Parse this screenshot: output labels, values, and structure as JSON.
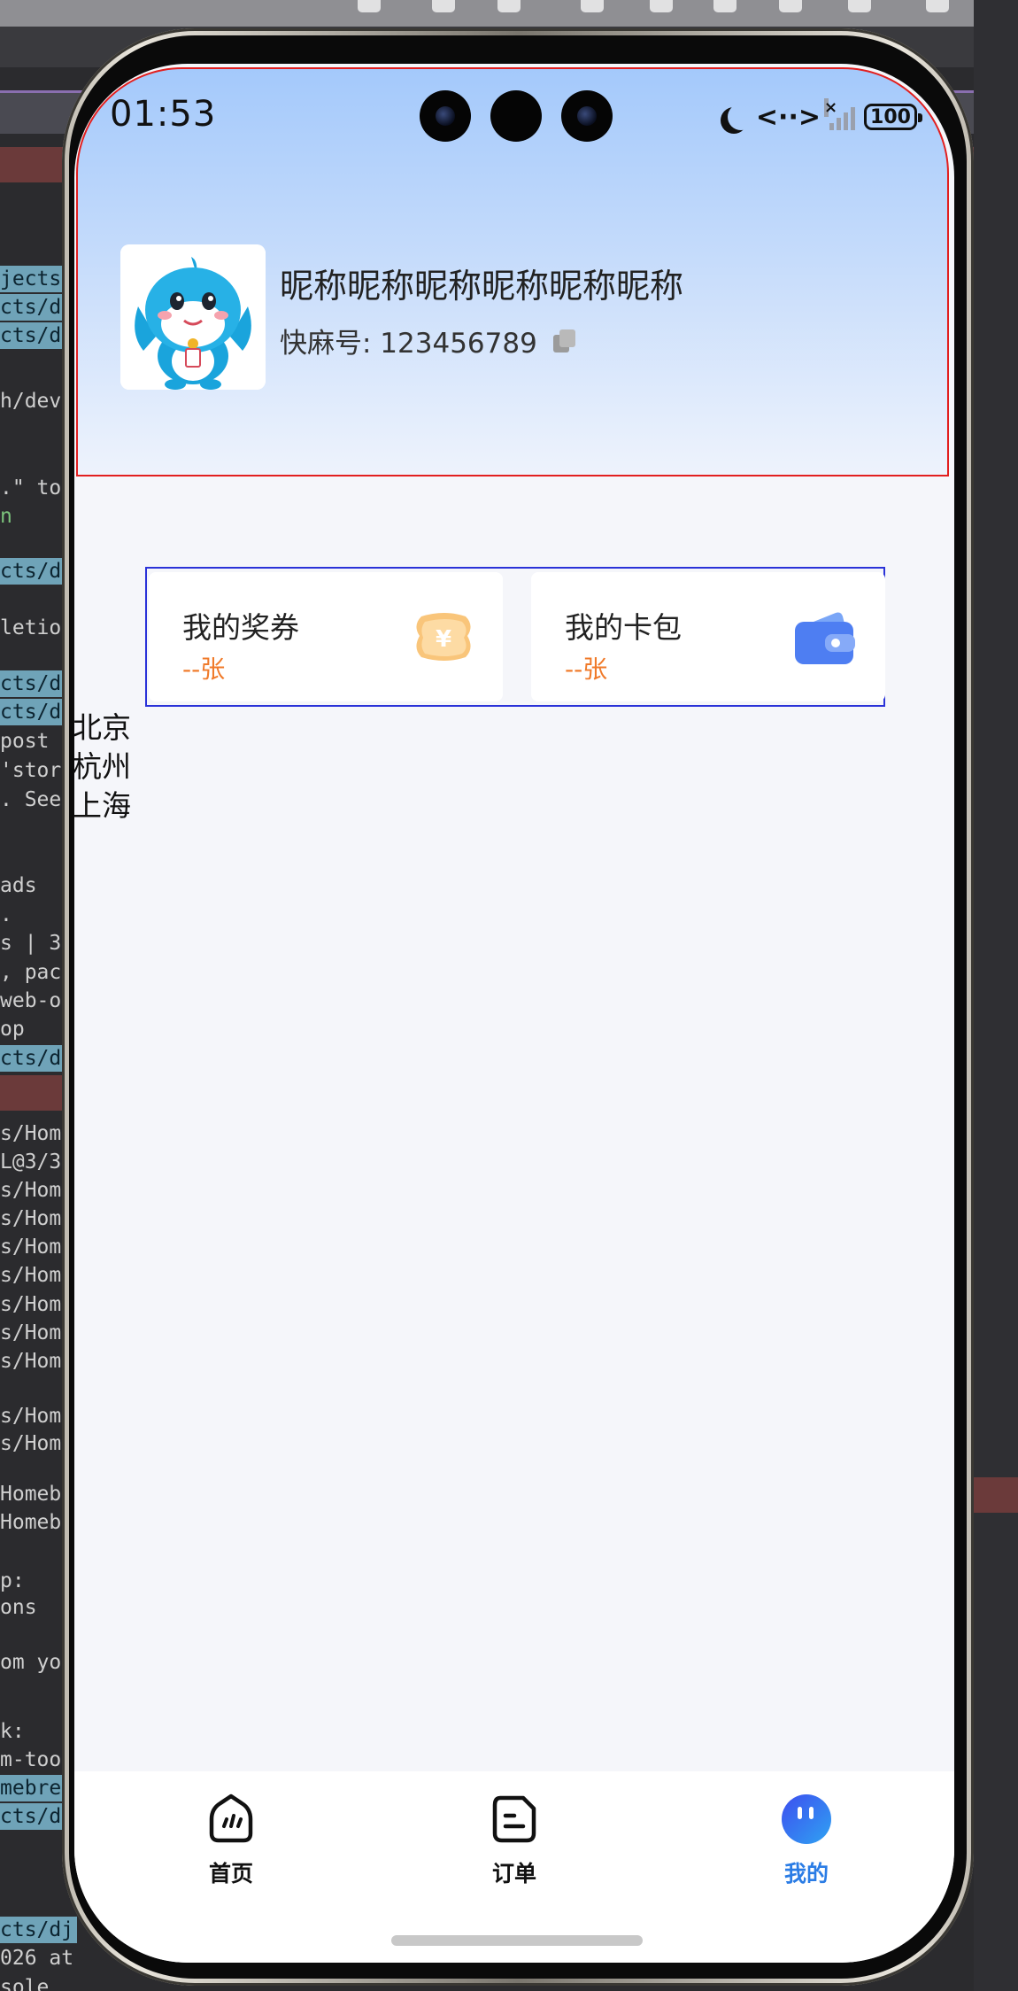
{
  "status_bar": {
    "time": "01:53",
    "battery": "100",
    "data_arrows": "<··>",
    "signal_x": "×"
  },
  "profile": {
    "nickname": "昵称昵称昵称昵称昵称昵称",
    "account_label": "快麻号: 123456789"
  },
  "cards": [
    {
      "title": "我的奖券",
      "count": "--张",
      "icon": "coupon-icon",
      "icon_mark": "¥"
    },
    {
      "title": "我的卡包",
      "count": "--张",
      "icon": "wallet-icon"
    }
  ],
  "cities": [
    "北京",
    "杭州",
    "上海"
  ],
  "tabbar": {
    "items": [
      {
        "label": "首页",
        "icon": "home-icon"
      },
      {
        "label": "订单",
        "icon": "order-icon"
      },
      {
        "label": "我的",
        "icon": "profile-face-icon",
        "active": true
      }
    ]
  },
  "terminal_background": {
    "lines": [
      "jects",
      "cts/d",
      "cts/d",
      "h/dev",
      ".\" to",
      "n",
      "cts/d",
      "letion",
      "cts/d",
      "cts/d",
      " post",
      "'stor",
      ". See",
      "ads",
      ".",
      "s | 3",
      ", pack",
      "web-o",
      "op",
      "cts/d",
      "s/Home",
      "L@3/3",
      "s/Home",
      "s/Home",
      "s/Home",
      "s/Home",
      "s/Home",
      "s/Home",
      "s/Home",
      "s/Home",
      "s/Home",
      "Homeb",
      "Homeb",
      "p:",
      "ons",
      "om yo",
      "k:",
      "m-too",
      "mebre",
      "cts/d",
      "cts/dj",
      "026 at",
      "sole"
    ]
  },
  "colors": {
    "accent_blue": "#2a7ce5",
    "count_orange": "#f07a2a",
    "header_border_red": "#e21f1f",
    "cards_border_blue": "#2a32d8"
  }
}
